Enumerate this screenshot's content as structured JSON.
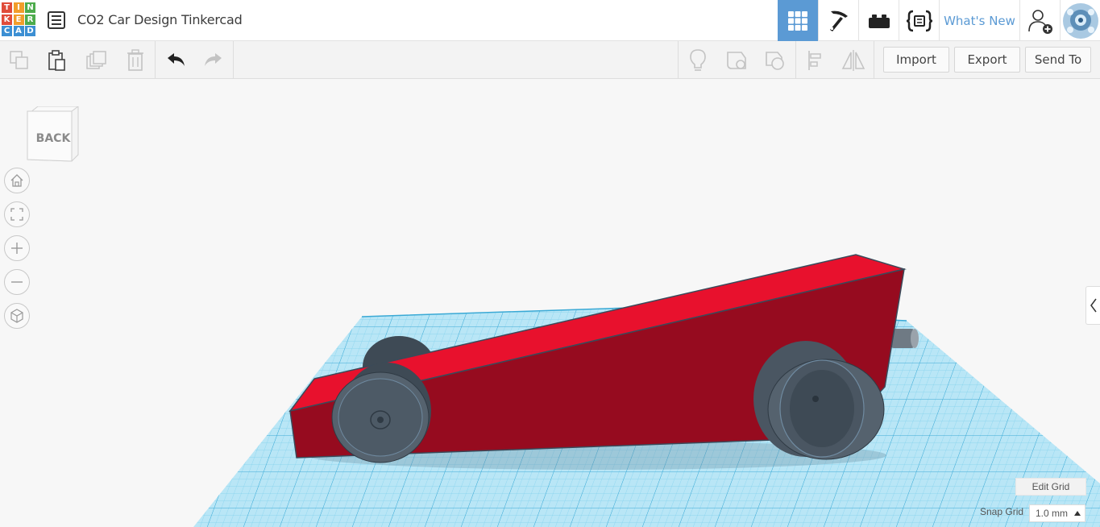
{
  "app": {
    "logo_letters": [
      "T",
      "I",
      "N",
      "K",
      "E",
      "R",
      "C",
      "A",
      "D"
    ],
    "logo_colors": [
      "#e04c3a",
      "#f29d2b",
      "#4dab4c",
      "#e04c3a",
      "#f29d2b",
      "#4dab4c",
      "#3c8fd3",
      "#3c8fd3",
      "#3c8fd3"
    ],
    "design_title": "CO2 Car Design Tinkercad"
  },
  "topbar": {
    "views": [
      {
        "name": "3d-design",
        "icon": "grid-icon",
        "active": true
      },
      {
        "name": "blocks",
        "icon": "pickaxe-icon",
        "active": false
      },
      {
        "name": "bricks",
        "icon": "brick-icon",
        "active": false
      },
      {
        "name": "codeblocks",
        "icon": "code-braces-icon",
        "active": false
      }
    ],
    "whats_new": "What's New",
    "add_user_icon": "add-user-icon",
    "avatar_icon": "avatar-icon"
  },
  "toolbar": {
    "copy_icon": "copy-icon",
    "paste_icon": "paste-icon",
    "duplicate_icon": "duplicate-icon",
    "delete_icon": "trash-icon",
    "undo_icon": "undo-icon",
    "redo_icon": "redo-icon",
    "hint_icon": "lightbulb-icon",
    "note_icon": "note-shape-icon",
    "group_icon": "group-icon",
    "align_icon": "align-icon",
    "mirror_icon": "mirror-icon",
    "import_label": "Import",
    "export_label": "Export",
    "send_to_label": "Send To"
  },
  "viewport": {
    "view_cube_face": "BACK",
    "nav": [
      "home-icon",
      "fit-view-icon",
      "zoom-in-icon",
      "zoom-out-icon",
      "ortho-view-icon"
    ],
    "workplane_color": "#5bc3e6",
    "car_body_color": "#e8112d",
    "wheel_color": "#4a5662",
    "edit_grid_label": "Edit Grid",
    "snap_grid_label": "Snap Grid",
    "snap_grid_value": "1.0 mm"
  }
}
